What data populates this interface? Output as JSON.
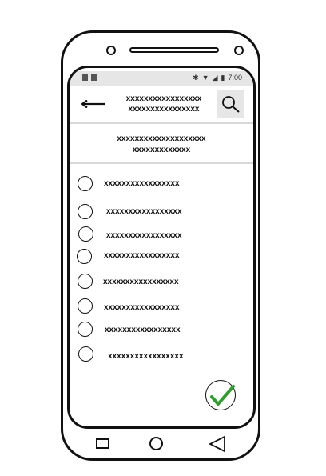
{
  "status": {
    "time": "7:00"
  },
  "appbar": {
    "title_line1": "xxxxxxxxxxxxxxxxx",
    "title_line2": "xxxxxxxxxxxxxxxx"
  },
  "subheader": {
    "line1": "xxxxxxxxxxxxxxxxxxxx",
    "line2": "xxxxxxxxxxxxx"
  },
  "options": [
    "xxxxxxxxxxxxxxxxx",
    "xxxxxxxxxxxxxxxxx",
    "xxxxxxxxxxxxxxxxx",
    "xxxxxxxxxxxxxxxxx",
    "xxxxxxxxxxxxxxxxx",
    "xxxxxxxxxxxxxxxxx",
    "xxxxxxxxxxxxxxxxx",
    "xxxxxxxxxxxxxxxxx"
  ],
  "icons": {
    "back": "arrow-left-icon",
    "search": "search-icon",
    "confirm": "checkmark-icon"
  },
  "colors": {
    "check": "#2e9e2e",
    "status_bar": "#e6e6e6"
  }
}
